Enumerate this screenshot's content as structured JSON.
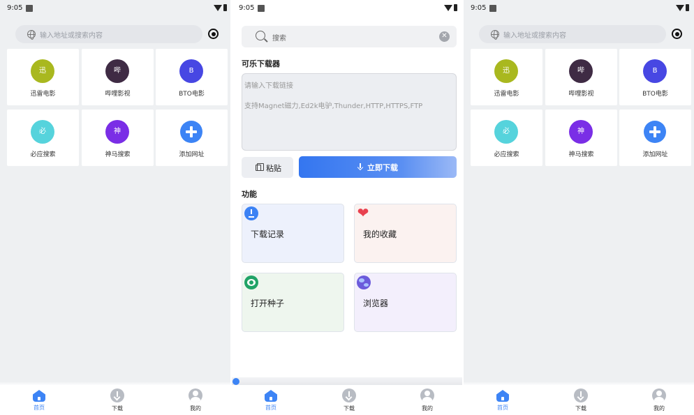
{
  "status_bar": {
    "time": "9:05"
  },
  "home": {
    "search_placeholder": "输入地址或搜索内容",
    "tiles": [
      {
        "glyph": "迅",
        "label": "迅雷电影",
        "color": "#a9b81f"
      },
      {
        "glyph": "哔",
        "label": "哔哩影视",
        "color": "#3f2b44"
      },
      {
        "glyph": "B",
        "label": "BTO电影",
        "color": "#4747e3"
      },
      {
        "glyph": "必",
        "label": "必应搜索",
        "color": "#56d3dc"
      },
      {
        "glyph": "神",
        "label": "神马搜索",
        "color": "#7a2ee6"
      },
      {
        "glyph": "",
        "label": "添加网址",
        "color": "#3d84f5"
      }
    ]
  },
  "downloader": {
    "search_placeholder": "搜索",
    "clear_icon": "✕",
    "title": "可乐下载器",
    "input_placeholder": "请输入下载链接",
    "input_hint": "支持Magnet磁力,Ed2k电驴,Thunder,HTTP,HTTPS,FTP",
    "paste_label": "粘贴",
    "download_label": "立即下载",
    "features_title": "功能",
    "features": [
      {
        "label": "下载记录",
        "icon": "download-record-icon",
        "bg": "#edf1fc"
      },
      {
        "label": "我的收藏",
        "icon": "heart-icon",
        "bg": "#fbf2f0"
      },
      {
        "label": "打开种子",
        "icon": "eye-icon",
        "bg": "#eef6ee"
      },
      {
        "label": "浏览器",
        "icon": "globe-icon",
        "bg": "#f3effc"
      }
    ],
    "heart_glyph": "❤"
  },
  "nav": {
    "items": [
      {
        "label": "首页",
        "icon": "home-icon",
        "active": true
      },
      {
        "label": "下载",
        "icon": "download-icon",
        "active": false
      },
      {
        "label": "我的",
        "icon": "user-icon",
        "active": false
      }
    ]
  },
  "colors": {
    "accent": "#3d84f5"
  }
}
